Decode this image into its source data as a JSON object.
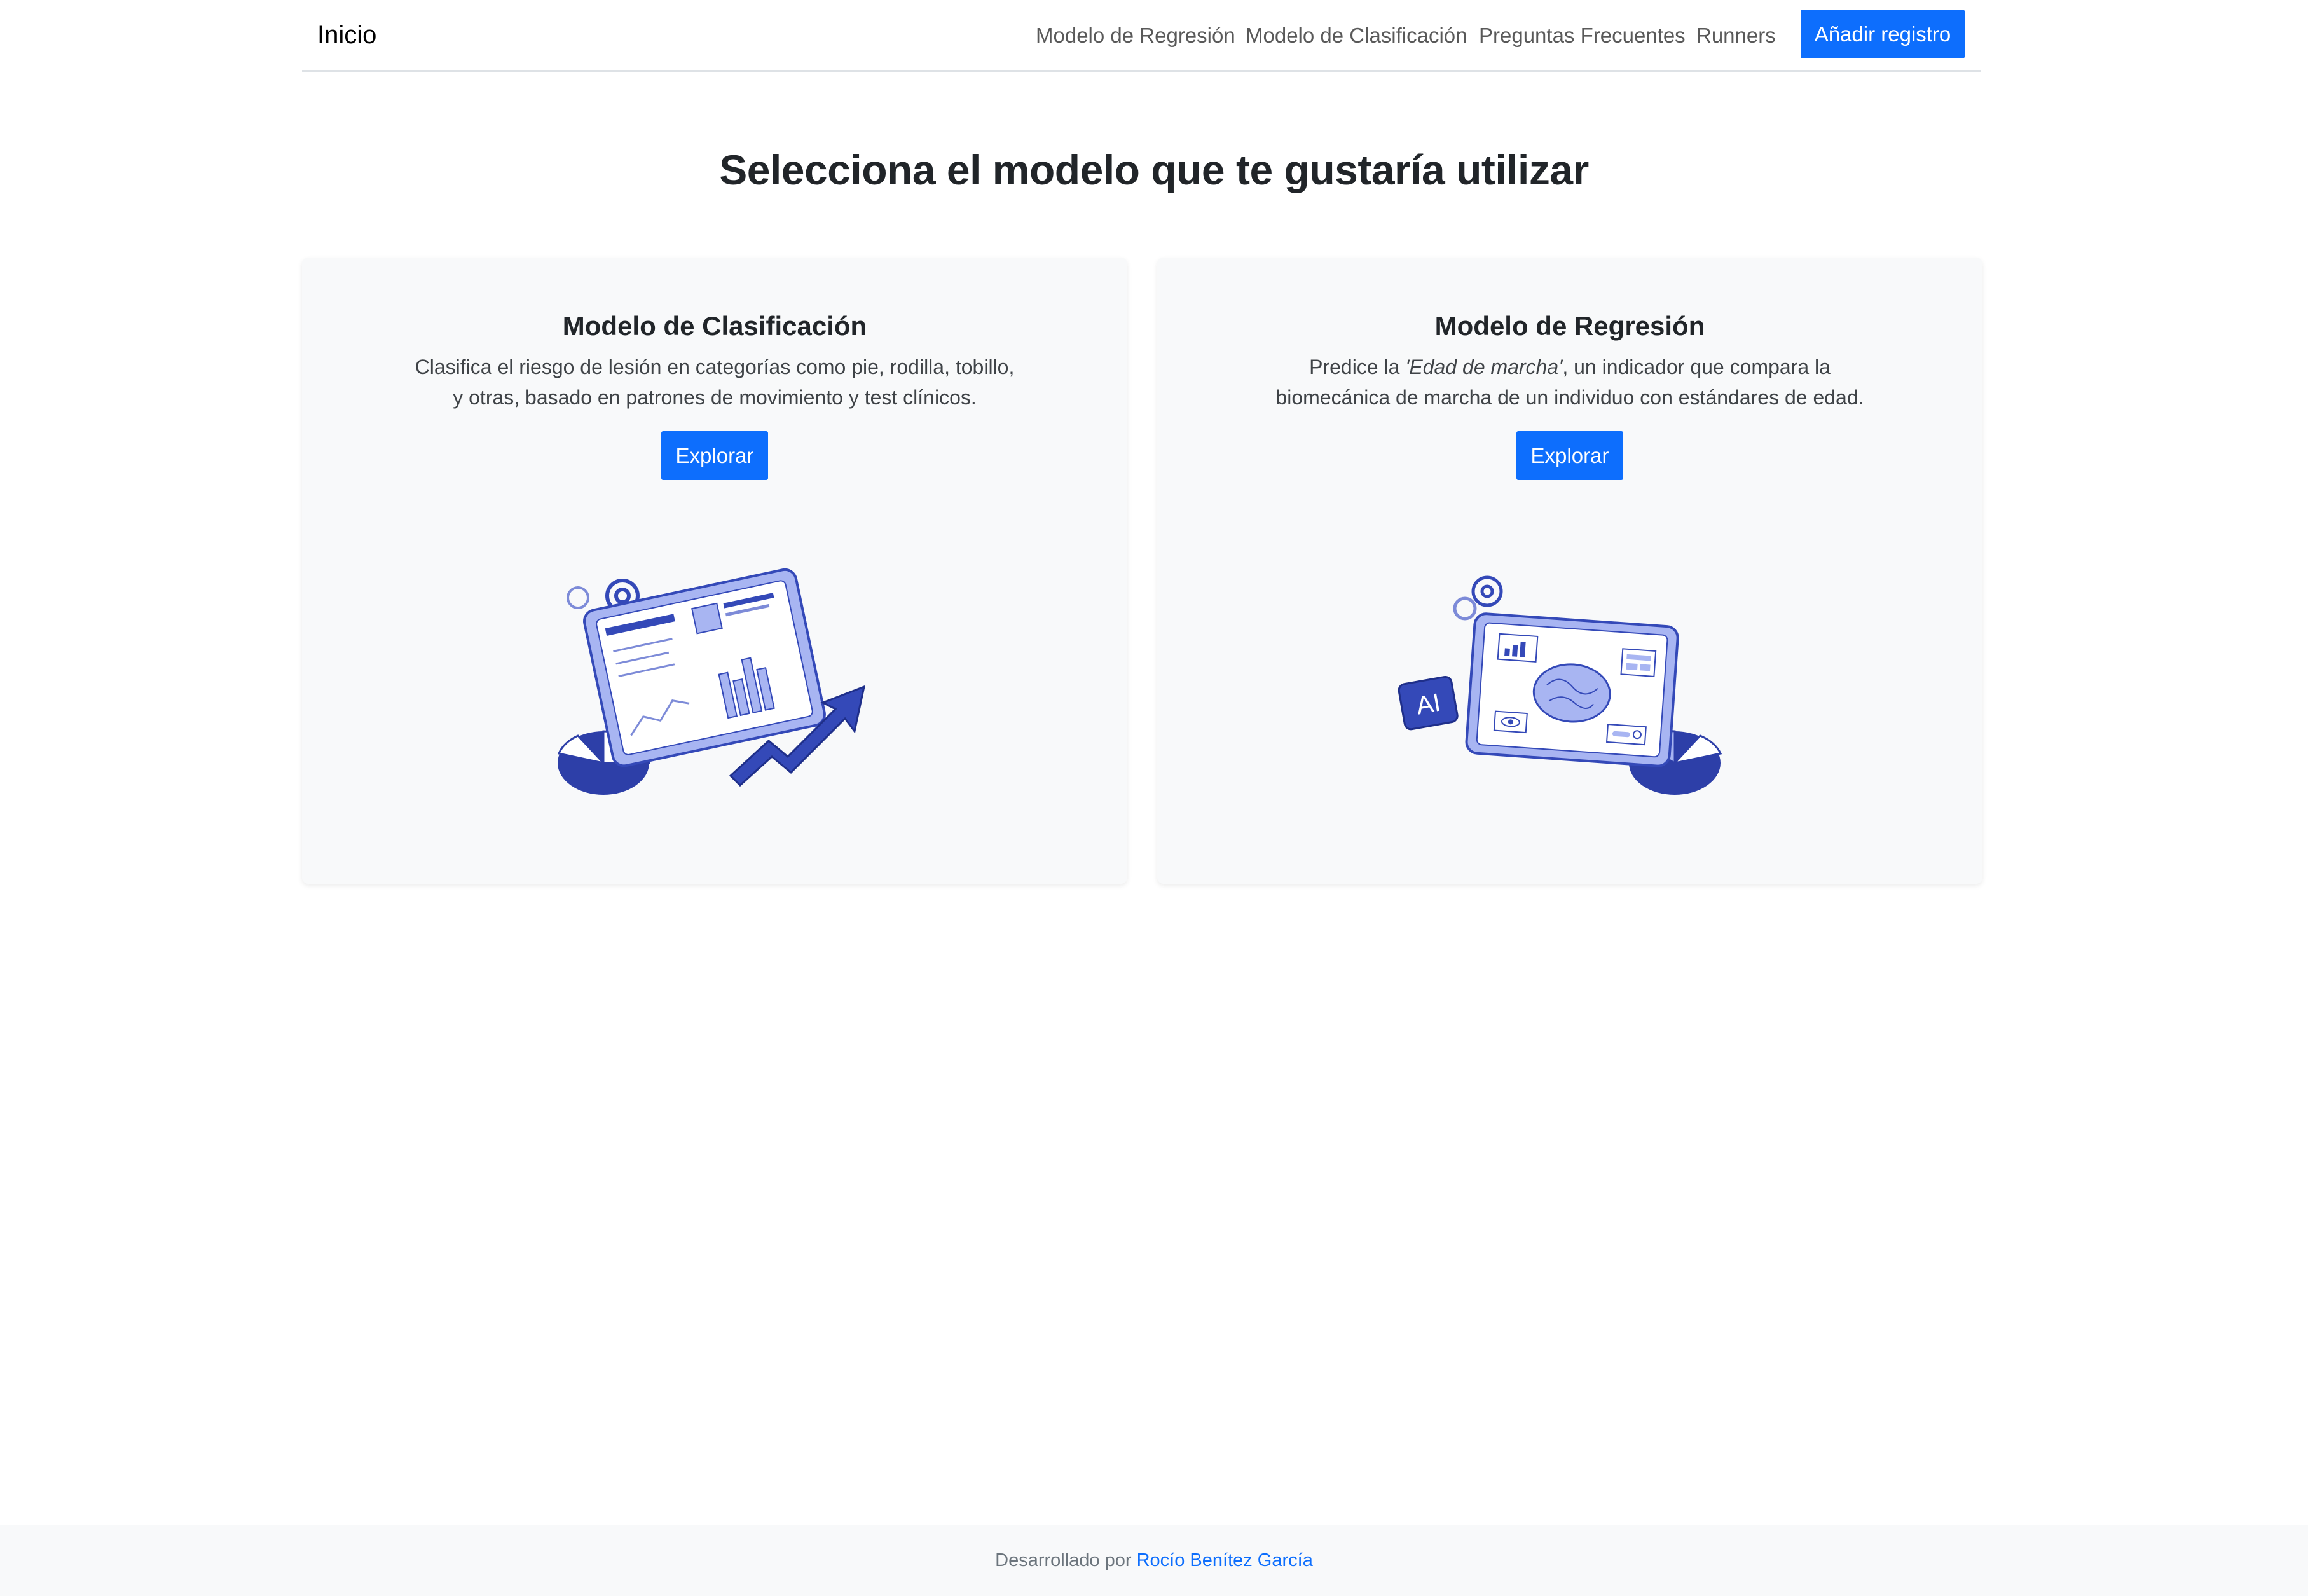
{
  "navbar": {
    "brand": "Inicio",
    "links": [
      "Modelo de Regresión",
      "Modelo de Clasificación",
      "Preguntas Frecuentes",
      "Runners"
    ],
    "cta_label": "Añadir registro"
  },
  "main": {
    "title": "Selecciona el modelo que te gustaría utilizar",
    "cards": [
      {
        "title": "Modelo de Clasificación",
        "text_line1": "Clasifica el riesgo de lesión en categorías como pie, rodilla, tobillo,",
        "text_line2": "y otras, basado en patrones de movimiento y test clínicos.",
        "button_label": "Explorar"
      },
      {
        "title": "Modelo de Regresión",
        "text_prefix": "Predice la ",
        "text_emphasis": "'Edad de marcha'",
        "text_suffix": ", un indicador que compara la",
        "text_line2": "biomecánica de marcha de un individuo con estándares de edad.",
        "illustration_badge": "AI",
        "button_label": "Explorar"
      }
    ]
  },
  "footer": {
    "prefix": "Desarrollado por",
    "author": "Rocío Benítez García"
  },
  "colors": {
    "primary": "#0d6efd",
    "card_bg": "#f8f9fa",
    "illustration_dark": "#3449b8",
    "illustration_light": "#a8b5f2"
  }
}
